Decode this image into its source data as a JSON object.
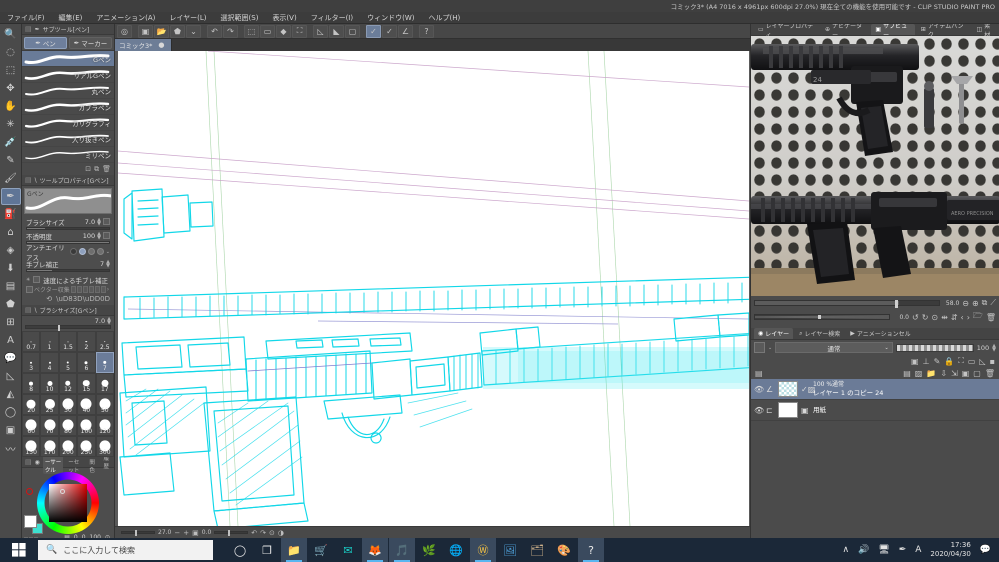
{
  "window": {
    "title": "コミック3* (A4 7016 x 4961px 600dpi 27.0%)  現在全ての機能を使用可能です - CLIP STUDIO PAINT PRO"
  },
  "menubar": {
    "items": [
      {
        "label": "ファイル(F)"
      },
      {
        "label": "編集(E)"
      },
      {
        "label": "アニメーション(A)"
      },
      {
        "label": "レイヤー(L)"
      },
      {
        "label": "選択範囲(S)"
      },
      {
        "label": "表示(V)"
      },
      {
        "label": "フィルター(I)"
      },
      {
        "label": "ウィンドウ(W)"
      },
      {
        "label": "ヘルプ(H)"
      }
    ]
  },
  "command_bar": {
    "icons": [
      {
        "name": "clip-studio-icon",
        "glyph": "◎"
      },
      {
        "name": "new-document-icon",
        "glyph": "▣"
      },
      {
        "name": "open-file-icon",
        "glyph": "📂"
      },
      {
        "name": "save-icon",
        "glyph": "⬟"
      },
      {
        "name": "save-dropdown-icon",
        "glyph": "⌄"
      },
      {
        "name": "undo-icon",
        "glyph": "↶"
      },
      {
        "name": "redo-icon",
        "glyph": "↷"
      },
      {
        "name": "select-all-icon",
        "glyph": "⬚"
      },
      {
        "name": "deselect-icon",
        "glyph": "▭"
      },
      {
        "name": "fill-selection-icon",
        "glyph": "◆"
      },
      {
        "name": "crop-icon",
        "glyph": "⛶"
      },
      {
        "name": "ruler-line-icon",
        "glyph": "◺"
      },
      {
        "name": "ruler-fill-icon",
        "glyph": "◣"
      },
      {
        "name": "ruler-square-icon",
        "glyph": "▢"
      },
      {
        "name": "snap-ruler-icon",
        "glyph": "✓"
      },
      {
        "name": "snap-special-ruler-icon",
        "glyph": "✓"
      },
      {
        "name": "snap-grid-icon",
        "glyph": "∠"
      },
      {
        "name": "help-icon",
        "glyph": "?"
      }
    ]
  },
  "document_tab": {
    "label": "コミック3*",
    "close_glyph": "●"
  },
  "tools": {
    "items": [
      {
        "name": "magnifier-tool",
        "glyph": "🔍",
        "selected": false
      },
      {
        "name": "lasso-select-tool",
        "glyph": "◌",
        "selected": false
      },
      {
        "name": "auto-select-tool",
        "glyph": "⬚",
        "selected": false
      },
      {
        "name": "move-tool",
        "glyph": "✥",
        "selected": false
      },
      {
        "name": "hand-tool",
        "glyph": "✋",
        "selected": false
      },
      {
        "name": "operation-tool",
        "glyph": "✳",
        "selected": false
      },
      {
        "name": "eyedropper-tool",
        "glyph": "💉",
        "selected": false
      },
      {
        "name": "pencil-tool",
        "glyph": "✎",
        "selected": false
      },
      {
        "name": "brush-tool",
        "glyph": "🖌",
        "selected": false
      },
      {
        "name": "pen-tool",
        "glyph": "✒",
        "selected": true
      },
      {
        "name": "airbrush-tool",
        "glyph": "⛽",
        "selected": false
      },
      {
        "name": "eraser-tool",
        "glyph": "⌂",
        "selected": false
      },
      {
        "name": "blend-tool",
        "glyph": "◈",
        "selected": false
      },
      {
        "name": "fill-bucket-tool",
        "glyph": "⬇",
        "selected": false
      },
      {
        "name": "gradient-tool",
        "glyph": "▤",
        "selected": false
      },
      {
        "name": "figure-tool",
        "glyph": "⬟",
        "selected": false
      },
      {
        "name": "frame-border-tool",
        "glyph": "⊞",
        "selected": false
      },
      {
        "name": "text-tool",
        "glyph": "A",
        "selected": false
      },
      {
        "name": "balloon-tool",
        "glyph": "💬",
        "selected": false
      },
      {
        "name": "ruler-tool",
        "glyph": "◺",
        "selected": false
      },
      {
        "name": "decoration-tool",
        "glyph": "◭",
        "selected": false
      },
      {
        "name": "ellipse-tool",
        "glyph": "◯",
        "selected": false
      },
      {
        "name": "color-swatch-tool",
        "glyph": "▣",
        "selected": false
      },
      {
        "name": "correct-line-tool",
        "glyph": "〰",
        "selected": false
      }
    ]
  },
  "sub_tool_panel": {
    "title": "サブツール[ペン]",
    "tabs": [
      {
        "name": "pen-tab",
        "label": "ペン",
        "selected": true
      },
      {
        "name": "marker-tab",
        "label": "マーカー",
        "selected": false
      }
    ],
    "items": [
      {
        "label": "Gペン",
        "selected": true
      },
      {
        "label": "リアルGペン",
        "selected": false
      },
      {
        "label": "丸ペン",
        "selected": false
      },
      {
        "label": "カブラペン",
        "selected": false
      },
      {
        "label": "カリグラフィ",
        "selected": false
      },
      {
        "label": "入り抜きペン",
        "selected": false
      },
      {
        "label": "ミリペン",
        "selected": false
      }
    ],
    "footer_icons": [
      {
        "name": "import-subtool-icon",
        "glyph": "⊡"
      },
      {
        "name": "duplicate-subtool-icon",
        "glyph": "⧉"
      },
      {
        "name": "delete-subtool-icon",
        "glyph": "🗑"
      }
    ]
  },
  "tool_property": {
    "title": "ツールプロパティ[Gペン]",
    "preview_label": "Gペン",
    "brush_size": {
      "label": "ブラシサイズ",
      "value": "7.0",
      "fill_pct": 22
    },
    "opacity": {
      "label": "不透明度",
      "value": "100",
      "fill_pct": 100
    },
    "antialias": {
      "label": "アンチエイリアス"
    },
    "stabilization": {
      "label": "手ブレ補正",
      "value": "7",
      "fill_pct": 30
    },
    "speed_stabilization": {
      "label": "速度による手ブレ補正"
    },
    "vector": {
      "label": "ベクター収集"
    }
  },
  "brush_size_panel": {
    "title": "ブラシサイズ[Gペン]",
    "current": "7.0",
    "sizes": [
      {
        "value": "0.7",
        "dot": 1
      },
      {
        "value": "1",
        "dot": 1
      },
      {
        "value": "1.5",
        "dot": 1
      },
      {
        "value": "2",
        "dot": 1.5
      },
      {
        "value": "2.5",
        "dot": 1.5
      },
      {
        "value": "3",
        "dot": 2
      },
      {
        "value": "4",
        "dot": 2
      },
      {
        "value": "5",
        "dot": 2.5
      },
      {
        "value": "6",
        "dot": 3
      },
      {
        "value": "7",
        "dot": 3.5,
        "selected": true
      },
      {
        "value": "8",
        "dot": 4
      },
      {
        "value": "10",
        "dot": 5
      },
      {
        "value": "12",
        "dot": 5.5
      },
      {
        "value": "15",
        "dot": 6.5
      },
      {
        "value": "17",
        "dot": 7
      },
      {
        "value": "20",
        "dot": 9
      },
      {
        "value": "25",
        "dot": 10
      },
      {
        "value": "30",
        "dot": 11
      },
      {
        "value": "40",
        "dot": 11
      },
      {
        "value": "50",
        "dot": 11
      },
      {
        "value": "60",
        "dot": 11
      },
      {
        "value": "70",
        "dot": 11
      },
      {
        "value": "80",
        "dot": 11
      },
      {
        "value": "100",
        "dot": 11
      },
      {
        "value": "120",
        "dot": 11
      },
      {
        "value": "150",
        "dot": 11
      },
      {
        "value": "170",
        "dot": 11
      },
      {
        "value": "200",
        "dot": 11
      },
      {
        "value": "250",
        "dot": 11
      },
      {
        "value": "300",
        "dot": 11
      }
    ]
  },
  "color_panel": {
    "title": "カラーサークル",
    "tabs": [
      {
        "name": "color-wheel-tab",
        "label": "カラーサークル",
        "selected": true
      },
      {
        "name": "color-set-tab",
        "label": "カラーセット",
        "selected": false
      },
      {
        "name": "intermediate-color-tab",
        "label": "中間色",
        "selected": false
      },
      {
        "name": "color-history-tab",
        "label": "履歴",
        "selected": false
      }
    ],
    "hsv": {
      "h": "0",
      "s": "0",
      "v": "100"
    },
    "main_color": "#ffffff",
    "sub_color": "#3de0d0"
  },
  "canvas": {
    "status": {
      "zoom": "27.0",
      "rotation": "0.0",
      "zoom_out_glyph": "−",
      "zoom_in_glyph": "+",
      "fit_glyph": "▣",
      "rotate_left_glyph": "↶",
      "rotate_right_glyph": "↷",
      "reset_glyph": "⊙",
      "flip_glyph": "◑"
    },
    "artwork_description": "cyan line-art sketch of an assault rifle"
  },
  "right_panel": {
    "top_tabs": [
      {
        "name": "tab-layer-property",
        "label": "レイヤープロパティ",
        "selected": false
      },
      {
        "name": "tab-navigator",
        "label": "ナビゲーター",
        "selected": false
      },
      {
        "name": "tab-subview",
        "label": "サブビュー",
        "selected": true
      },
      {
        "name": "tab-item-bank",
        "label": "アイテムバンク",
        "selected": false
      },
      {
        "name": "tab-material",
        "label": "素材",
        "selected": false
      }
    ],
    "subview": {
      "zoom": "58.0",
      "rotation": "0.0",
      "icons": [
        {
          "name": "zoom-out-icon",
          "glyph": "⊖"
        },
        {
          "name": "zoom-in-icon",
          "glyph": "⊕"
        },
        {
          "name": "fit-to-window-icon",
          "glyph": "⧉"
        },
        {
          "name": "eyedropper-icon",
          "glyph": "⟋"
        },
        {
          "name": "rotate-left-icon",
          "glyph": "↺"
        },
        {
          "name": "rotate-right-icon",
          "glyph": "↻"
        },
        {
          "name": "reset-rotation-icon",
          "glyph": "⊙"
        },
        {
          "name": "flip-horizontal-icon",
          "glyph": "⇹"
        },
        {
          "name": "flip-vertical-icon",
          "glyph": "⇵"
        },
        {
          "name": "prev-image-icon",
          "glyph": "‹"
        },
        {
          "name": "next-image-icon",
          "glyph": "›"
        },
        {
          "name": "import-image-icon",
          "glyph": "📁"
        },
        {
          "name": "delete-image-icon",
          "glyph": "🗑"
        }
      ]
    },
    "layer_panel": {
      "tabs": [
        {
          "name": "tab-layer",
          "label": "レイヤー",
          "selected": true
        },
        {
          "name": "tab-layer-search",
          "label": "レイヤー検索",
          "selected": false
        },
        {
          "name": "tab-animation-cels",
          "label": "アニメーションセル",
          "selected": false
        }
      ],
      "blend_mode": "通常",
      "opacity": "100",
      "property_icons": [
        {
          "name": "clip-to-layer-below-icon",
          "glyph": "▣"
        },
        {
          "name": "reference-layer-icon",
          "glyph": "⊥"
        },
        {
          "name": "draft-layer-icon",
          "glyph": "✎"
        },
        {
          "name": "lock-layer-icon",
          "glyph": "🔒"
        },
        {
          "name": "lock-transparent-pixels-icon",
          "glyph": "⛶"
        },
        {
          "name": "layer-mask-icon",
          "glyph": "▭"
        },
        {
          "name": "ruler-scope-icon",
          "glyph": "◺"
        },
        {
          "name": "palette-color-icon",
          "glyph": "▪"
        }
      ],
      "action_icons": [
        {
          "name": "new-raster-layer-icon",
          "glyph": "▤"
        },
        {
          "name": "new-tone-layer-icon",
          "glyph": "▨"
        },
        {
          "name": "new-folder-icon",
          "glyph": "📁"
        },
        {
          "name": "transfer-down-icon",
          "glyph": "⇩"
        },
        {
          "name": "merge-down-icon",
          "glyph": "⇲"
        },
        {
          "name": "create-mask-icon",
          "glyph": "▣"
        },
        {
          "name": "apply-mask-icon",
          "glyph": "▢"
        },
        {
          "name": "delete-layer-icon",
          "glyph": "🗑"
        }
      ],
      "layers": [
        {
          "name": "layer-copy-24",
          "blend_info": "100 %通常",
          "label": "レイヤー 1 のコピー 24",
          "selected": true,
          "thumb": "checker"
        },
        {
          "name": "paper-layer",
          "blend_info": "",
          "label": "用紙",
          "selected": false,
          "thumb": "white"
        }
      ]
    }
  },
  "taskbar": {
    "start_glyph": "⊞",
    "search_placeholder": "ここに入力して検索",
    "search_icon_glyph": "🔍",
    "apps": [
      {
        "name": "cortana-icon",
        "glyph": "◯",
        "color": "#e6e6e6",
        "active": false
      },
      {
        "name": "task-view-icon",
        "glyph": "❐",
        "color": "#e6e6e6",
        "active": false
      },
      {
        "name": "file-explorer-icon",
        "glyph": "📁",
        "color": "#f3b93b",
        "active": true
      },
      {
        "name": "microsoft-store-icon",
        "glyph": "🛒",
        "color": "#2f9de0",
        "active": false
      },
      {
        "name": "mail-icon",
        "glyph": "✉",
        "color": "#1ad0c8",
        "active": false
      },
      {
        "name": "firefox-icon",
        "glyph": "🦊",
        "color": "#ff7139",
        "active": true
      },
      {
        "name": "itunes-icon",
        "glyph": "🎵",
        "color": "#f04c8a",
        "active": true
      },
      {
        "name": "game-icon",
        "glyph": "🌿",
        "color": "#6ab04c",
        "active": false
      },
      {
        "name": "browser-icon",
        "glyph": "🌐",
        "color": "#3aa3e3",
        "active": false
      },
      {
        "name": "winamp-icon",
        "glyph": "Ⓦ",
        "color": "#f6c344",
        "active": true
      },
      {
        "name": "photos-icon",
        "glyph": "🖼",
        "color": "#4fa3dd",
        "active": false
      },
      {
        "name": "explorer2-icon",
        "glyph": "🗂",
        "color": "#d2b48c",
        "active": false
      },
      {
        "name": "clip-studio-launcher-icon",
        "glyph": "🎨",
        "color": "#7fd2e8",
        "active": false
      },
      {
        "name": "clip-studio-paint-icon",
        "glyph": "?",
        "color": "#e8e8e8",
        "active": true
      }
    ],
    "tray": [
      {
        "name": "show-hidden-icons",
        "glyph": "∧"
      },
      {
        "name": "volume-icon",
        "glyph": "🔊"
      },
      {
        "name": "network-icon",
        "glyph": "🖥"
      },
      {
        "name": "pen-input-icon",
        "glyph": "✒"
      },
      {
        "name": "ime-icon",
        "glyph": "A"
      }
    ],
    "clock": {
      "time": "17:36",
      "date": "2020/04/30"
    },
    "action_center_glyph": "💬"
  }
}
